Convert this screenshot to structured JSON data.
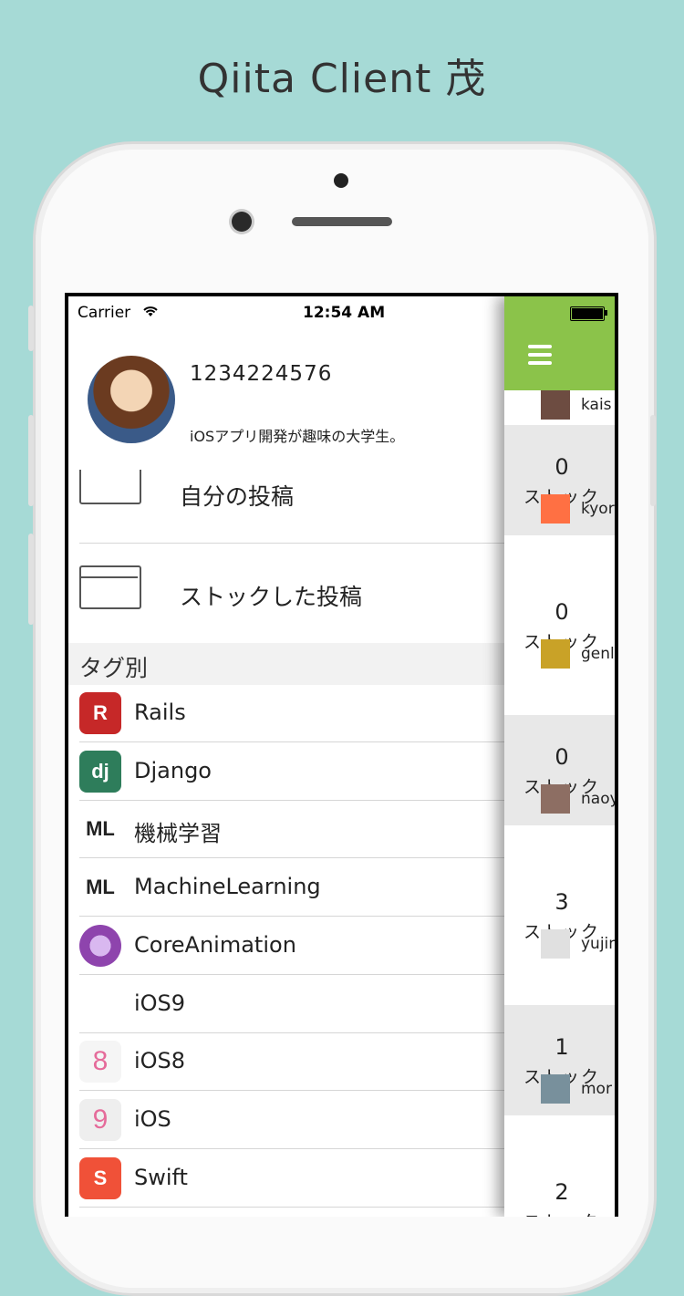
{
  "promo": {
    "title": "Qiita Client 茂"
  },
  "status": {
    "carrier": "Carrier",
    "time": "12:54 AM"
  },
  "profile": {
    "user_id": "1234224576",
    "bio": "iOSアプリ開発が趣味の大学生。"
  },
  "menu": [
    {
      "label": "自分の投稿",
      "icon": "document-icon"
    },
    {
      "label": "ストックした投稿",
      "icon": "folder-icon"
    }
  ],
  "tags_section": {
    "header": "タグ別"
  },
  "tags": [
    {
      "label": "Rails",
      "icon": "rails-icon",
      "color": "#c62828",
      "glyph": "R"
    },
    {
      "label": "Django",
      "icon": "django-icon",
      "color": "#2e7d5b",
      "glyph": "dj"
    },
    {
      "label": "機械学習",
      "icon": "machine-learning-icon",
      "color": "#ffffff",
      "glyph": "ML"
    },
    {
      "label": "MachineLearning",
      "icon": "machine-learning-icon",
      "color": "#ffffff",
      "glyph": "ML"
    },
    {
      "label": "CoreAnimation",
      "icon": "core-animation-icon",
      "color": "#8e44ad",
      "glyph": ""
    },
    {
      "label": "iOS9",
      "icon": "",
      "color": "#ffffff",
      "glyph": ""
    },
    {
      "label": "iOS8",
      "icon": "ios8-icon",
      "color": "#f5f5f5",
      "glyph": "8"
    },
    {
      "label": "iOS",
      "icon": "ios9-icon",
      "color": "#eeeeee",
      "glyph": "9"
    },
    {
      "label": "Swift",
      "icon": "swift-icon",
      "color": "#f05138",
      "glyph": "S"
    }
  ],
  "panel": {
    "stock_label": "ストック",
    "users_and_stocks": [
      {
        "user": "kais",
        "count": "0",
        "shade": "#e8e8e8"
      },
      {
        "user": "kyor",
        "count": "0",
        "shade": "#ffffff"
      },
      {
        "user": "genl",
        "count": "0",
        "shade": "#e8e8e8"
      },
      {
        "user": "naoy",
        "count": "3",
        "shade": "#ffffff"
      },
      {
        "user": "yujin",
        "count": "1",
        "shade": "#e8e8e8"
      },
      {
        "user": "mor",
        "count": "2",
        "shade": "#ffffff"
      }
    ]
  },
  "colors": {
    "background": "#a6dad6",
    "accent": "#8bc34a"
  }
}
